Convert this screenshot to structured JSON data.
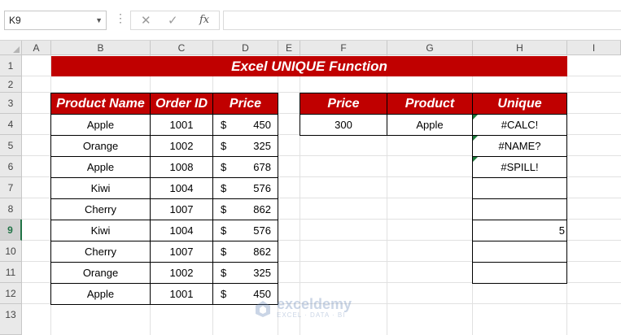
{
  "formula_bar": {
    "name_box": "K9",
    "formula": "",
    "fx_label": "fx",
    "cancel_icon": "✕",
    "enter_icon": "✓",
    "dots": "⋮"
  },
  "columns": [
    "A",
    "B",
    "C",
    "D",
    "E",
    "F",
    "G",
    "H",
    "I"
  ],
  "rows": [
    "1",
    "2",
    "3",
    "4",
    "5",
    "6",
    "7",
    "8",
    "9",
    "10",
    "11",
    "12",
    "13"
  ],
  "active_row": "9",
  "title": "Excel UNIQUE Function",
  "main_table": {
    "headers": [
      "Product Name",
      "Order ID",
      "Price"
    ],
    "currency_symbol": "$",
    "rows": [
      {
        "product": "Apple",
        "order_id": "1001",
        "price": "450"
      },
      {
        "product": "Orange",
        "order_id": "1002",
        "price": "325"
      },
      {
        "product": "Apple",
        "order_id": "1008",
        "price": "678"
      },
      {
        "product": "Kiwi",
        "order_id": "1004",
        "price": "576"
      },
      {
        "product": "Cherry",
        "order_id": "1007",
        "price": "862"
      },
      {
        "product": "Kiwi",
        "order_id": "1004",
        "price": "576"
      },
      {
        "product": "Cherry",
        "order_id": "1007",
        "price": "862"
      },
      {
        "product": "Orange",
        "order_id": "1002",
        "price": "325"
      },
      {
        "product": "Apple",
        "order_id": "1001",
        "price": "450"
      }
    ]
  },
  "criteria_table": {
    "headers": [
      "Price",
      "Product"
    ],
    "values": [
      "300",
      "Apple"
    ]
  },
  "unique_table": {
    "header": "Unique",
    "values": [
      "#CALC!",
      "#NAME?",
      "#SPILL!",
      "",
      "",
      "5",
      "",
      ""
    ]
  },
  "watermark": {
    "brand": "exceldemy",
    "tagline": "EXCEL · DATA · BI"
  },
  "colors": {
    "header_red": "#c00000",
    "excel_green": "#217346"
  }
}
